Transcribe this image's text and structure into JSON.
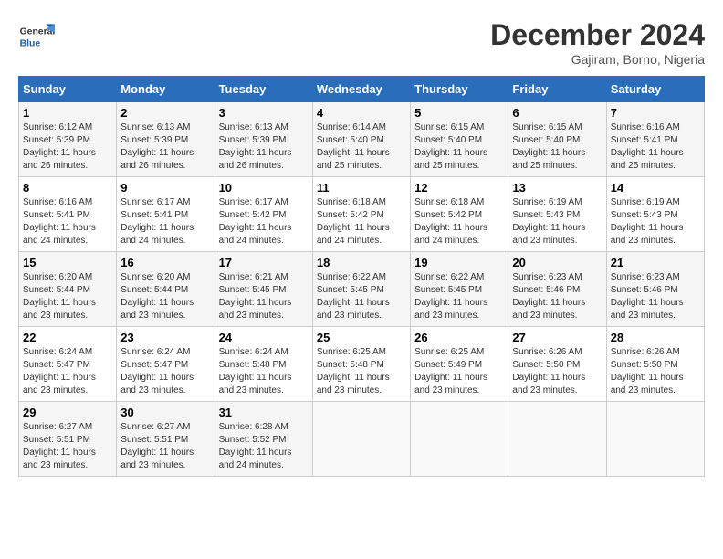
{
  "logo": {
    "line1": "General",
    "line2": "Blue"
  },
  "title": {
    "month_year": "December 2024",
    "location": "Gajiram, Borno, Nigeria"
  },
  "days_of_week": [
    "Sunday",
    "Monday",
    "Tuesday",
    "Wednesday",
    "Thursday",
    "Friday",
    "Saturday"
  ],
  "weeks": [
    [
      {
        "day": "1",
        "sunrise": "6:12 AM",
        "sunset": "5:39 PM",
        "daylight": "11 hours and 26 minutes."
      },
      {
        "day": "2",
        "sunrise": "6:13 AM",
        "sunset": "5:39 PM",
        "daylight": "11 hours and 26 minutes."
      },
      {
        "day": "3",
        "sunrise": "6:13 AM",
        "sunset": "5:39 PM",
        "daylight": "11 hours and 26 minutes."
      },
      {
        "day": "4",
        "sunrise": "6:14 AM",
        "sunset": "5:40 PM",
        "daylight": "11 hours and 25 minutes."
      },
      {
        "day": "5",
        "sunrise": "6:15 AM",
        "sunset": "5:40 PM",
        "daylight": "11 hours and 25 minutes."
      },
      {
        "day": "6",
        "sunrise": "6:15 AM",
        "sunset": "5:40 PM",
        "daylight": "11 hours and 25 minutes."
      },
      {
        "day": "7",
        "sunrise": "6:16 AM",
        "sunset": "5:41 PM",
        "daylight": "11 hours and 25 minutes."
      }
    ],
    [
      {
        "day": "8",
        "sunrise": "6:16 AM",
        "sunset": "5:41 PM",
        "daylight": "11 hours and 24 minutes."
      },
      {
        "day": "9",
        "sunrise": "6:17 AM",
        "sunset": "5:41 PM",
        "daylight": "11 hours and 24 minutes."
      },
      {
        "day": "10",
        "sunrise": "6:17 AM",
        "sunset": "5:42 PM",
        "daylight": "11 hours and 24 minutes."
      },
      {
        "day": "11",
        "sunrise": "6:18 AM",
        "sunset": "5:42 PM",
        "daylight": "11 hours and 24 minutes."
      },
      {
        "day": "12",
        "sunrise": "6:18 AM",
        "sunset": "5:42 PM",
        "daylight": "11 hours and 24 minutes."
      },
      {
        "day": "13",
        "sunrise": "6:19 AM",
        "sunset": "5:43 PM",
        "daylight": "11 hours and 23 minutes."
      },
      {
        "day": "14",
        "sunrise": "6:19 AM",
        "sunset": "5:43 PM",
        "daylight": "11 hours and 23 minutes."
      }
    ],
    [
      {
        "day": "15",
        "sunrise": "6:20 AM",
        "sunset": "5:44 PM",
        "daylight": "11 hours and 23 minutes."
      },
      {
        "day": "16",
        "sunrise": "6:20 AM",
        "sunset": "5:44 PM",
        "daylight": "11 hours and 23 minutes."
      },
      {
        "day": "17",
        "sunrise": "6:21 AM",
        "sunset": "5:45 PM",
        "daylight": "11 hours and 23 minutes."
      },
      {
        "day": "18",
        "sunrise": "6:22 AM",
        "sunset": "5:45 PM",
        "daylight": "11 hours and 23 minutes."
      },
      {
        "day": "19",
        "sunrise": "6:22 AM",
        "sunset": "5:45 PM",
        "daylight": "11 hours and 23 minutes."
      },
      {
        "day": "20",
        "sunrise": "6:23 AM",
        "sunset": "5:46 PM",
        "daylight": "11 hours and 23 minutes."
      },
      {
        "day": "21",
        "sunrise": "6:23 AM",
        "sunset": "5:46 PM",
        "daylight": "11 hours and 23 minutes."
      }
    ],
    [
      {
        "day": "22",
        "sunrise": "6:24 AM",
        "sunset": "5:47 PM",
        "daylight": "11 hours and 23 minutes."
      },
      {
        "day": "23",
        "sunrise": "6:24 AM",
        "sunset": "5:47 PM",
        "daylight": "11 hours and 23 minutes."
      },
      {
        "day": "24",
        "sunrise": "6:24 AM",
        "sunset": "5:48 PM",
        "daylight": "11 hours and 23 minutes."
      },
      {
        "day": "25",
        "sunrise": "6:25 AM",
        "sunset": "5:48 PM",
        "daylight": "11 hours and 23 minutes."
      },
      {
        "day": "26",
        "sunrise": "6:25 AM",
        "sunset": "5:49 PM",
        "daylight": "11 hours and 23 minutes."
      },
      {
        "day": "27",
        "sunrise": "6:26 AM",
        "sunset": "5:50 PM",
        "daylight": "11 hours and 23 minutes."
      },
      {
        "day": "28",
        "sunrise": "6:26 AM",
        "sunset": "5:50 PM",
        "daylight": "11 hours and 23 minutes."
      }
    ],
    [
      {
        "day": "29",
        "sunrise": "6:27 AM",
        "sunset": "5:51 PM",
        "daylight": "11 hours and 23 minutes."
      },
      {
        "day": "30",
        "sunrise": "6:27 AM",
        "sunset": "5:51 PM",
        "daylight": "11 hours and 23 minutes."
      },
      {
        "day": "31",
        "sunrise": "6:28 AM",
        "sunset": "5:52 PM",
        "daylight": "11 hours and 24 minutes."
      },
      null,
      null,
      null,
      null
    ]
  ]
}
